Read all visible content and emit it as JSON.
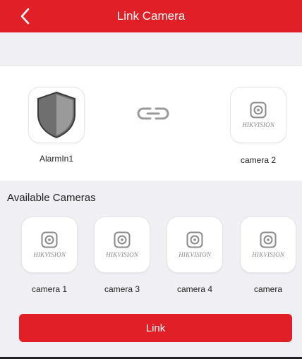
{
  "header": {
    "title": "Link Camera",
    "back_icon": "chevron-left-icon"
  },
  "link_panel": {
    "alarm_input": {
      "label": "AlarmIn1",
      "icon": "shield-icon"
    },
    "link_icon": "link-icon",
    "linked_camera": {
      "label": "camera 2",
      "logo": "HIKVISION"
    }
  },
  "available": {
    "title": "Available Cameras",
    "cameras": [
      {
        "label": "camera 1",
        "logo": "HIKVISION"
      },
      {
        "label": "camera 3",
        "logo": "HIKVISION"
      },
      {
        "label": "camera 4",
        "logo": "HIKVISION"
      },
      {
        "label": "camera",
        "logo": "HIKVISION"
      }
    ]
  },
  "actions": {
    "link_label": "Link"
  },
  "colors": {
    "accent": "#e11f26",
    "background": "#efeff4",
    "shield_gray": "#7b7b7b"
  }
}
